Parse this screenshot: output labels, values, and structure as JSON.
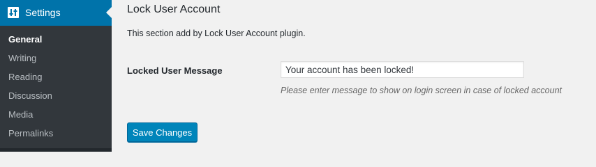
{
  "sidebar": {
    "menu_title": "Settings",
    "items": [
      {
        "label": "General"
      },
      {
        "label": "Writing"
      },
      {
        "label": "Reading"
      },
      {
        "label": "Discussion"
      },
      {
        "label": "Media"
      },
      {
        "label": "Permalinks"
      }
    ],
    "icon": "settings-sliders-icon",
    "colors": {
      "background": "#32373c",
      "active": "#0073aa"
    }
  },
  "section": {
    "title": "Lock User Account",
    "description": "This section add by Lock User Account plugin.",
    "field_label": "Locked User Message",
    "field_value": "Your account has been locked!",
    "help_text": "Please enter message to show on login screen in case of locked account"
  },
  "actions": {
    "save_label": "Save Changes",
    "accent": "#0085ba"
  }
}
